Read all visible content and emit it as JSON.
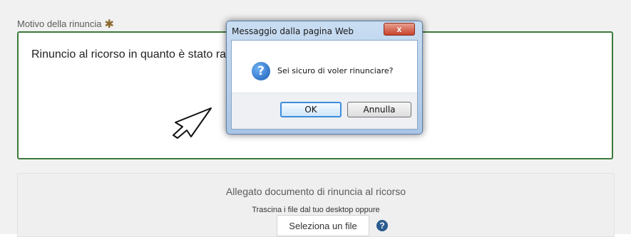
{
  "form": {
    "reason_label": "Motivo della rinuncia",
    "required_icon": "asterisk-icon",
    "reason_text": "Rinuncio al ricorso in quanto è stato ra",
    "border_color": "#3c7a3c"
  },
  "upload": {
    "title": "Allegato documento di rinuncia al ricorso",
    "hint": "Trascina i file dal tuo desktop oppure",
    "select_label": "Seleziona un file",
    "help_icon": "question-circle-icon"
  },
  "dialog": {
    "title": "Messaggio dalla pagina Web",
    "close_label": "x",
    "icon": "question-icon",
    "message": "Sei sicuro di voler rinunciare?",
    "ok_label": "OK",
    "cancel_label": "Annulla"
  },
  "cursor": {
    "icon": "pointer-cursor-icon"
  }
}
